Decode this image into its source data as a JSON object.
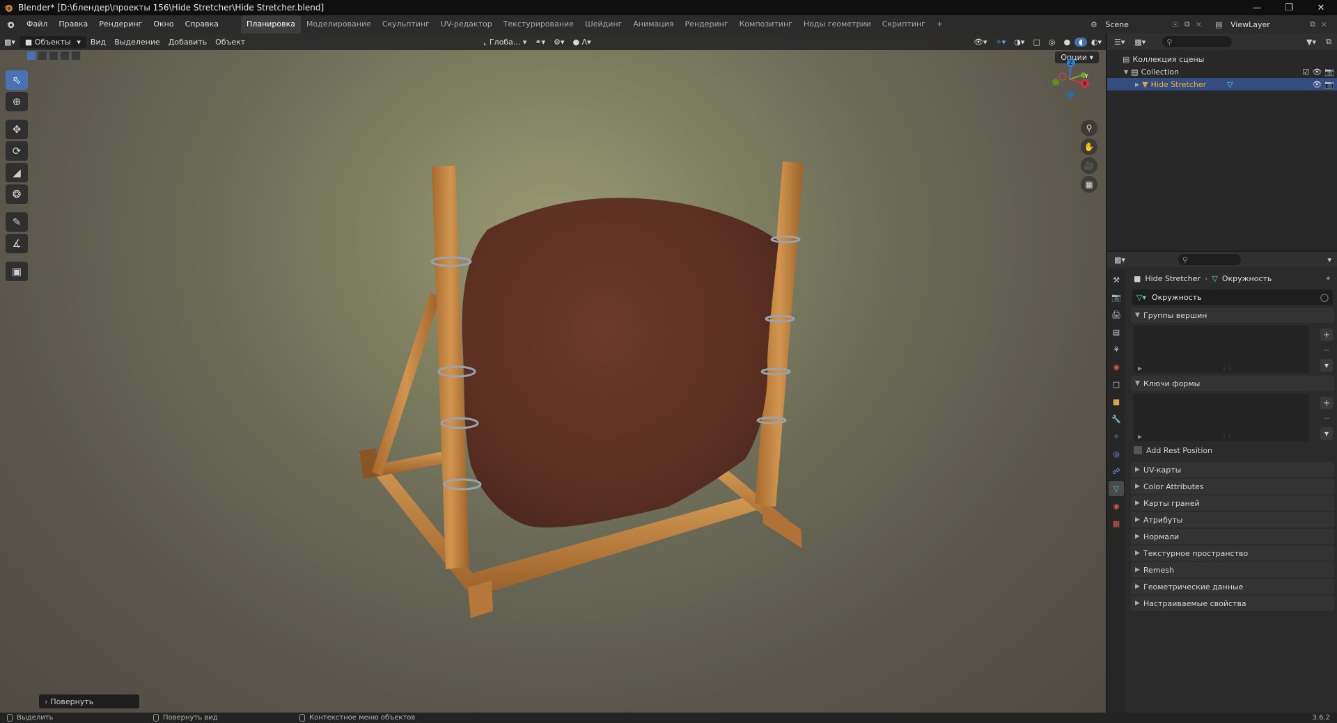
{
  "titlebar": {
    "title": "Blender* [D:\\блендер\\проекты 156\\Hide Stretcher\\Hide Stretcher.blend]",
    "window_controls": [
      "minimize-icon",
      "restore-icon",
      "close-icon"
    ]
  },
  "menu": {
    "items": [
      "Файл",
      "Правка",
      "Рендеринг",
      "Окно",
      "Справка"
    ]
  },
  "workspaces": {
    "tabs": [
      "Планировка",
      "Моделирование",
      "Скульптинг",
      "UV-редактор",
      "Текстурирование",
      "Шейдинг",
      "Анимация",
      "Рендеринг",
      "Композитинг",
      "Ноды геометрии",
      "Скриптинг"
    ],
    "active_index": 0,
    "add_label": "+"
  },
  "scene": {
    "name": "Scene"
  },
  "view_layer": {
    "name": "ViewLayer"
  },
  "viewport": {
    "mode": "Объекты",
    "header_menu": [
      "Вид",
      "Выделение",
      "Добавить",
      "Объект"
    ],
    "transform_orientation": "Глоба...",
    "options_label": "Опции",
    "gizmo": {
      "x": "X",
      "y": "Y",
      "z": "Z"
    },
    "operator_panel_label": "Повернуть",
    "tools": [
      "select-box-icon",
      "cursor-icon",
      "move-icon",
      "rotate-icon",
      "scale-icon",
      "transform-icon",
      "annotate-icon",
      "measure-icon",
      "add-cube-icon"
    ],
    "active_tool_index": 0
  },
  "outliner": {
    "root": "Коллекция сцены",
    "collection": "Collection",
    "object": "Hide Stretcher"
  },
  "properties": {
    "breadcrumb": {
      "object": "Hide Stretcher",
      "data": "Окружность"
    },
    "datablock": "Окружность",
    "panels": {
      "vertex_groups": "Группы вершин",
      "shape_keys": "Ключи формы",
      "add_rest_position": "Add Rest Position"
    },
    "collapsed_panels": [
      "UV-карты",
      "Color Attributes",
      "Карты граней",
      "Атрибуты",
      "Нормали",
      "Текстурное пространство",
      "Remesh",
      "Геометрические данные",
      "Настраиваемые свойства"
    ]
  },
  "statusbar": {
    "left": "Выделить",
    "middle": "Повернуть вид",
    "right": "Контекстное меню объектов",
    "version": "3.6.2"
  },
  "colors": {
    "accent": "#4772b3",
    "selected_row": "#334d80",
    "object_orange": "#e0a050",
    "hide_brown": "#5a2e22",
    "wood": "#c68a46"
  }
}
